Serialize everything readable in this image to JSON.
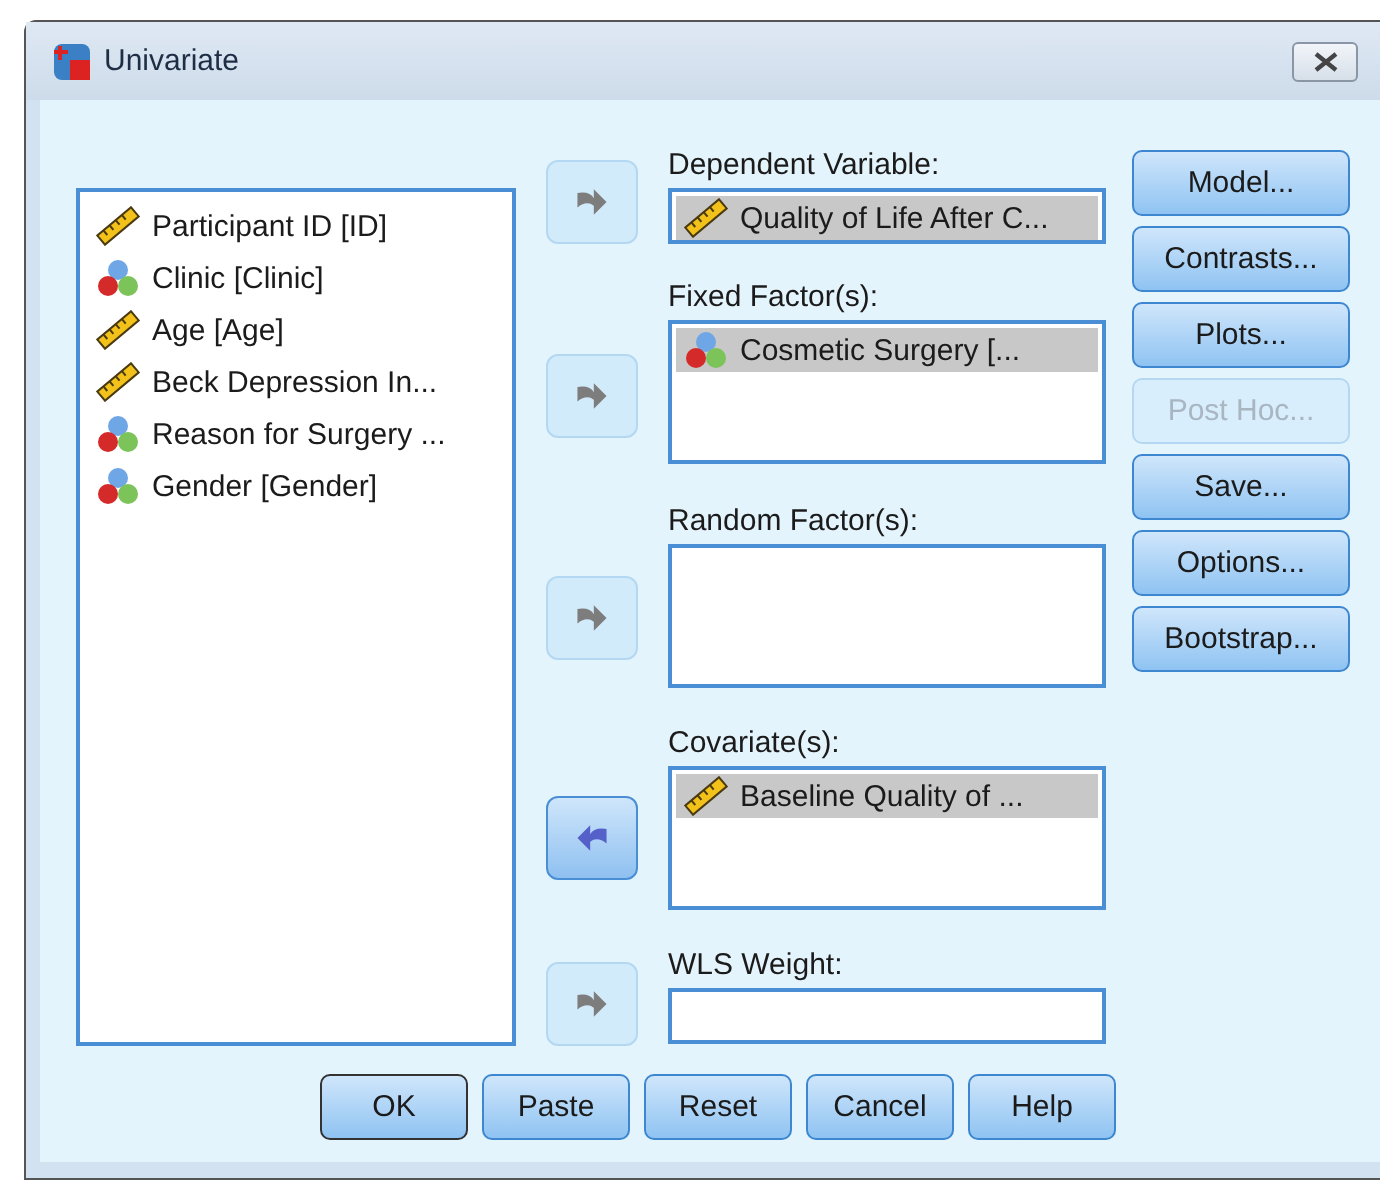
{
  "window": {
    "title": "Univariate"
  },
  "source_variables": [
    {
      "label": "Participant ID [ID]",
      "kind": "scale"
    },
    {
      "label": "Clinic [Clinic]",
      "kind": "nominal"
    },
    {
      "label": "Age [Age]",
      "kind": "scale"
    },
    {
      "label": "Beck Depression In...",
      "kind": "scale"
    },
    {
      "label": "Reason for Surgery ...",
      "kind": "nominal"
    },
    {
      "label": "Gender [Gender]",
      "kind": "nominal"
    }
  ],
  "targets": [
    {
      "label": "Dependent Variable:",
      "kind": "single",
      "arrow": {
        "kind": "right",
        "active": false
      },
      "items": [
        {
          "label": "Quality of Life After C...",
          "kind": "scale",
          "selected": true
        }
      ]
    },
    {
      "label": "Fixed Factor(s):",
      "kind": "multi",
      "arrow": {
        "kind": "right",
        "active": false
      },
      "items": [
        {
          "label": "Cosmetic Surgery [...",
          "kind": "nominal",
          "selected": true
        }
      ]
    },
    {
      "label": "Random Factor(s):",
      "kind": "multi",
      "arrow": {
        "kind": "right",
        "active": false
      }
    },
    {
      "label": "Covariate(s):",
      "kind": "multi",
      "arrow": {
        "kind": "left",
        "active": true
      },
      "items": [
        {
          "label": "Baseline Quality of ...",
          "kind": "scale",
          "selected": true
        }
      ]
    },
    {
      "label": "WLS Weight:",
      "kind": "single",
      "arrow": {
        "kind": "right",
        "active": false
      }
    }
  ],
  "side_buttons": [
    {
      "label": "Model...",
      "disabled": false
    },
    {
      "label": "Contrasts...",
      "disabled": false
    },
    {
      "label": "Plots...",
      "disabled": false
    },
    {
      "label": "Post Hoc...",
      "disabled": true
    },
    {
      "label": "Save...",
      "disabled": false
    },
    {
      "label": "Options...",
      "disabled": false
    },
    {
      "label": "Bootstrap...",
      "disabled": false
    }
  ],
  "bottom_buttons": [
    {
      "label": "OK",
      "default": true
    },
    {
      "label": "Paste",
      "default": false
    },
    {
      "label": "Reset",
      "default": false
    },
    {
      "label": "Cancel",
      "default": false
    },
    {
      "label": "Help",
      "default": false
    }
  ]
}
